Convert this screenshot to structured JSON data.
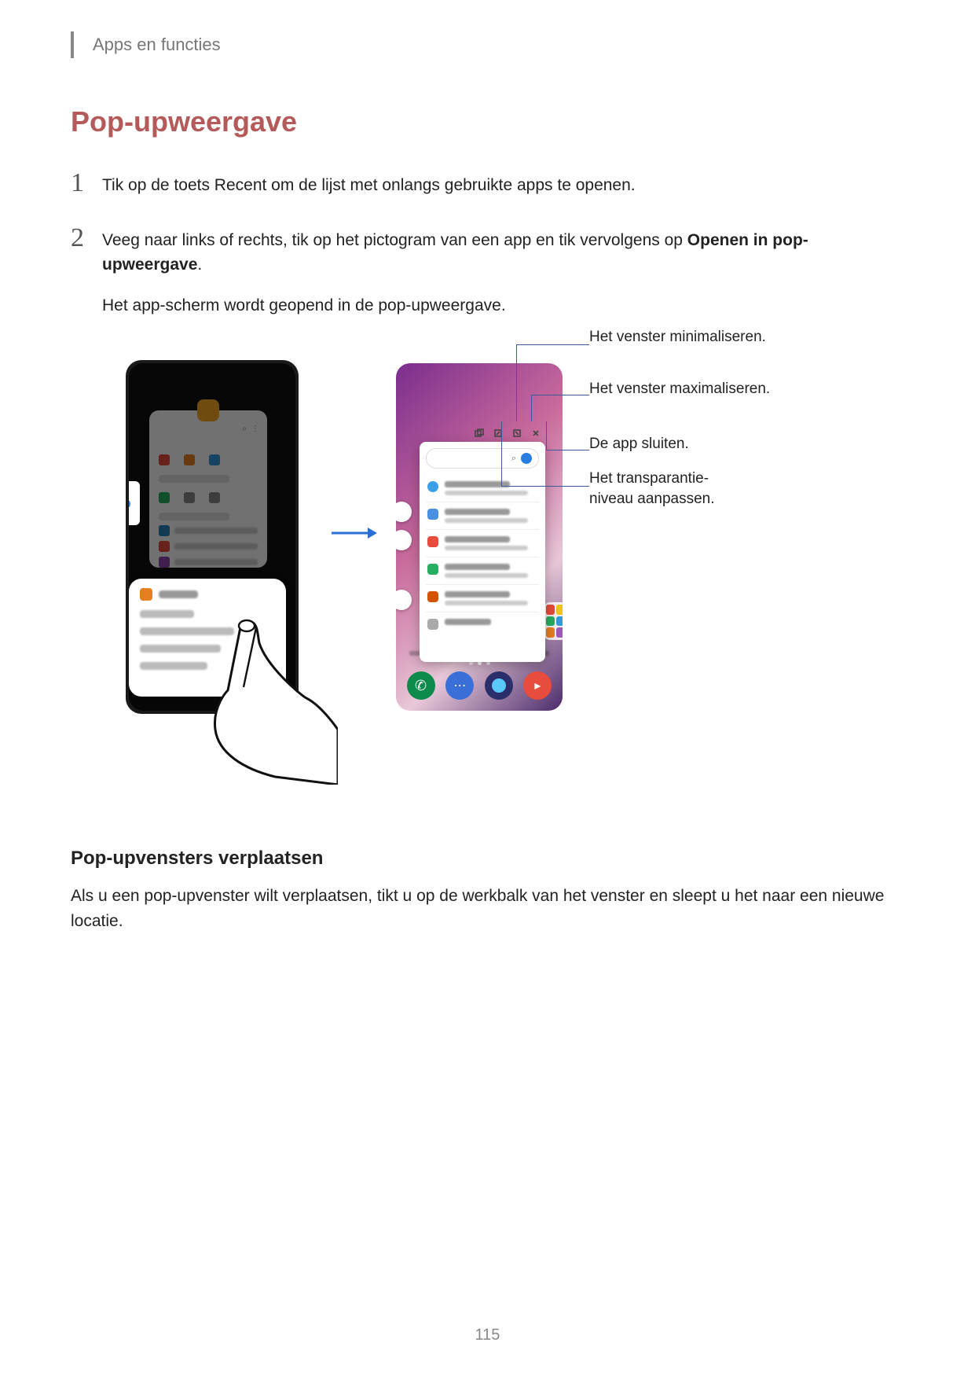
{
  "header": {
    "breadcrumb": "Apps en functies"
  },
  "section": {
    "title": "Pop-upweergave"
  },
  "steps": [
    {
      "num": "1",
      "text": "Tik op de toets Recent om de lijst met onlangs gebruikte apps te openen."
    },
    {
      "num": "2",
      "text_pre": "Veeg naar links of rechts, tik op het pictogram van een app en tik vervolgens op ",
      "text_bold": "Openen in pop-upweergave",
      "text_post": ".",
      "sub": "Het app-scherm wordt geopend in de pop-upweergave."
    }
  ],
  "callouts": {
    "minimize": "Het venster minimaliseren.",
    "maximize": "Het venster maximaliseren.",
    "close": "De app sluiten.",
    "transparency": "Het transparantie-\nniveau aanpassen."
  },
  "subheading": "Pop-upvensters verplaatsen",
  "para": "Als u een pop-upvenster wilt verplaatsen, tikt u op de werkbalk van het venster en sleept u het naar een nieuwe locatie.",
  "page_number": "115"
}
